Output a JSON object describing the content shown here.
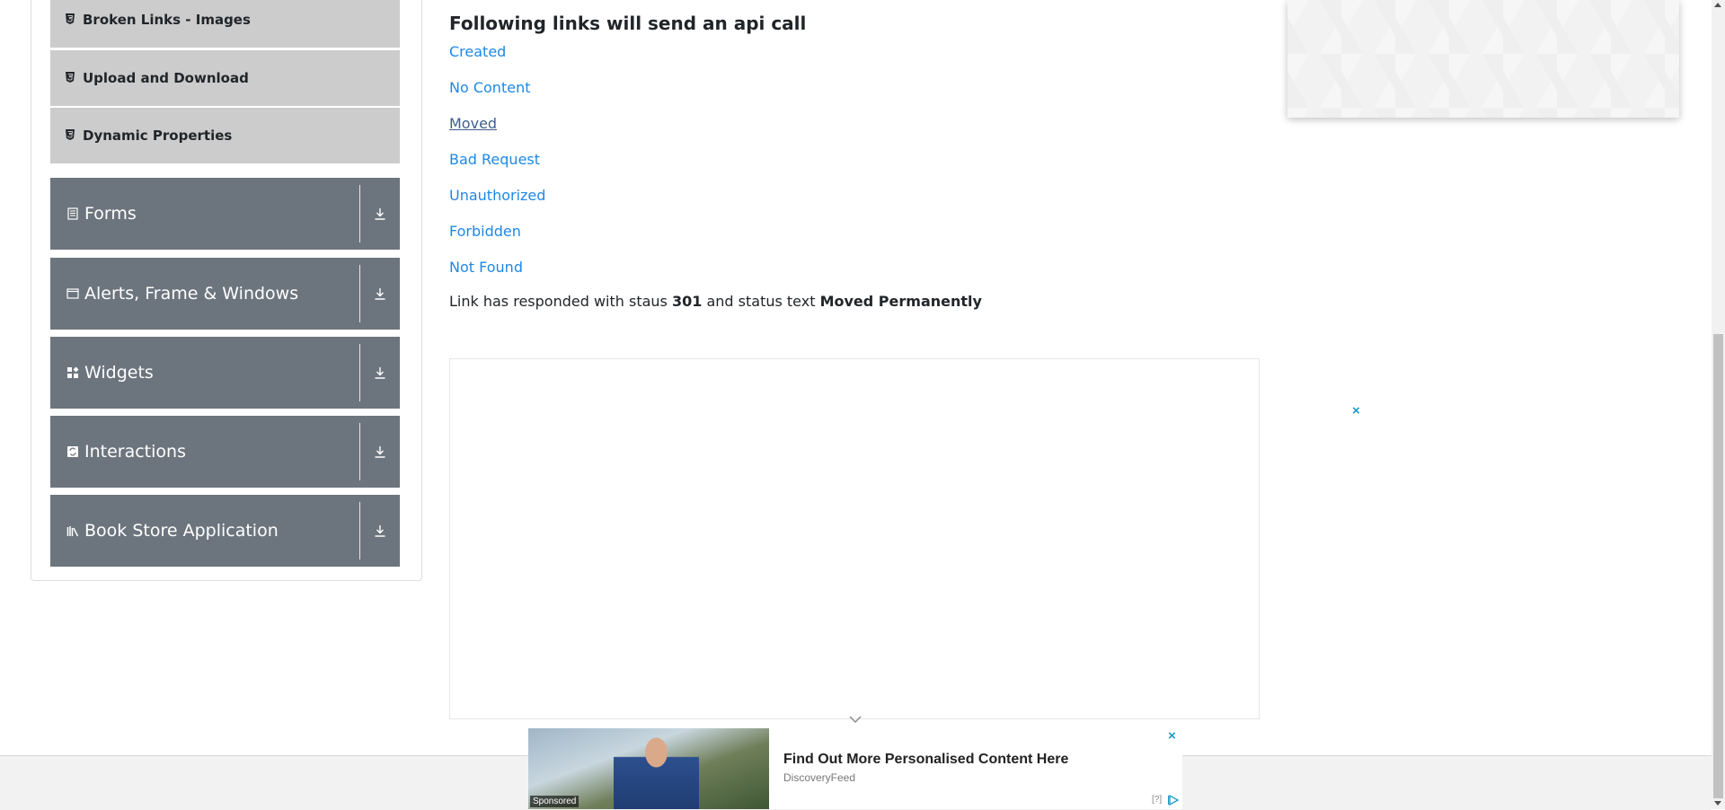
{
  "sidebar": {
    "sub_items": [
      {
        "label": "Broken Links - Images",
        "icon": "html5-icon"
      },
      {
        "label": "Upload and Download",
        "icon": "html5-icon"
      },
      {
        "label": "Dynamic Properties",
        "icon": "html5-icon"
      }
    ],
    "groups": [
      {
        "label": "Forms",
        "icon": "document-icon"
      },
      {
        "label": "Alerts, Frame & Windows",
        "icon": "window-icon"
      },
      {
        "label": "Widgets",
        "icon": "widgets-icon"
      },
      {
        "label": "Interactions",
        "icon": "interactions-icon"
      },
      {
        "label": "Book Store Application",
        "icon": "book-store-icon"
      }
    ]
  },
  "main": {
    "title": "Following links will send an api call",
    "links": [
      "Created",
      "No Content",
      "Moved",
      "Bad Request",
      "Unauthorized",
      "Forbidden",
      "Not Found"
    ],
    "response": {
      "prefix": "Link has responded with staus",
      "status_code": "301",
      "middle": "and status text",
      "status_text": "Moved Permanently"
    }
  },
  "ads": {
    "close_symbol": "×",
    "sticky": {
      "headline": "Find Out More Personalised Content Here",
      "source": "DiscoveryFeed",
      "sponsored": "Sponsored",
      "info": "[?]"
    }
  },
  "colors": {
    "link": "#1e88e5",
    "group_bg": "#6c757d",
    "sub_item_bg": "#cccccc"
  }
}
